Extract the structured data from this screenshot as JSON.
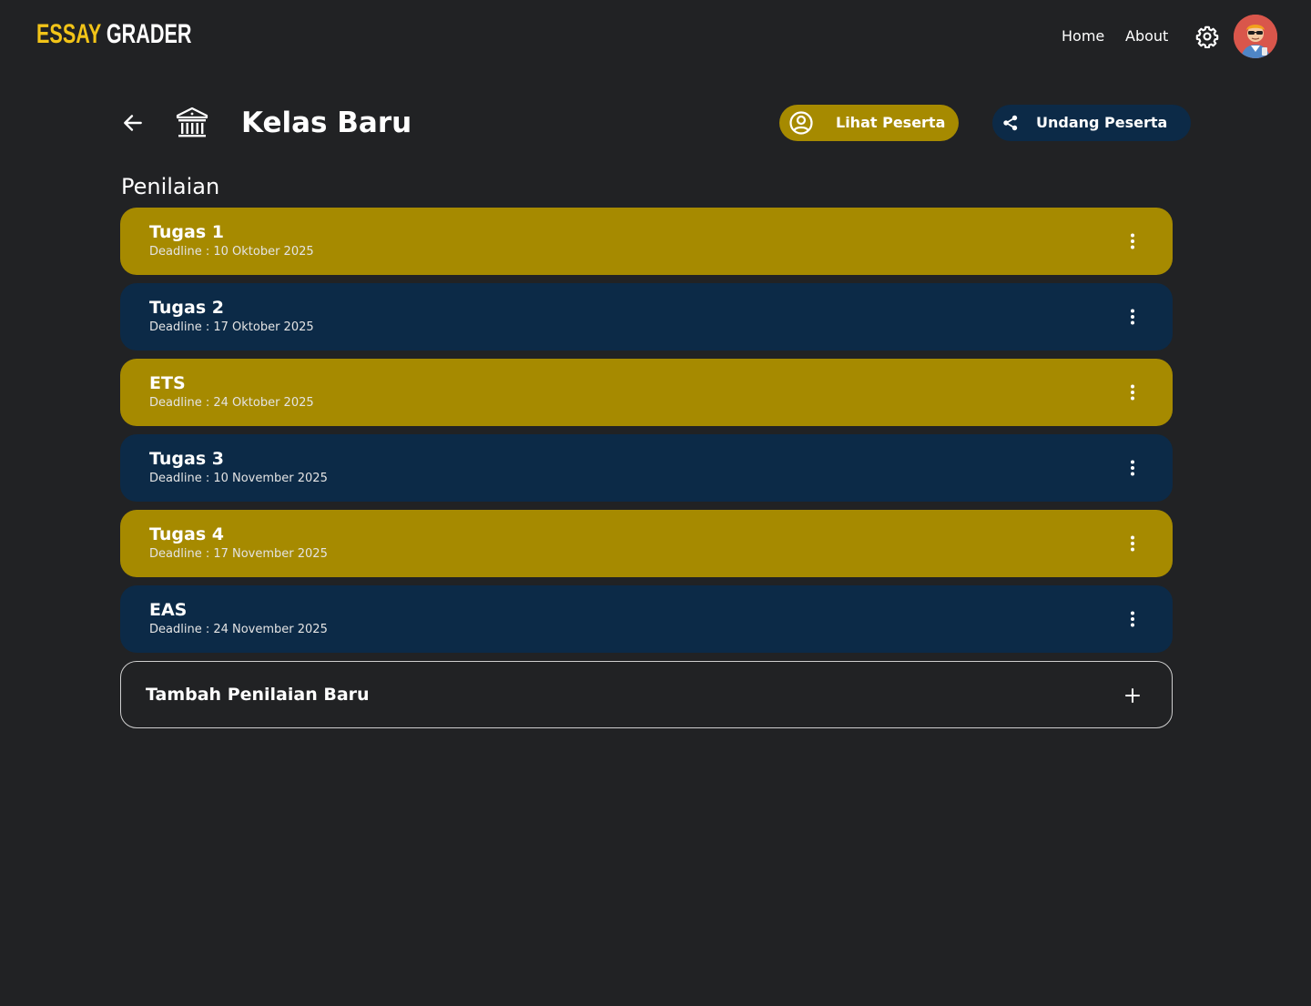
{
  "app": {
    "logo_part1": "ESSAY",
    "logo_part2": "GRADER"
  },
  "nav": {
    "home": "Home",
    "about": "About"
  },
  "page": {
    "title": "Kelas Baru",
    "section_title": "Penilaian",
    "btn_lihat": "Lihat Peserta",
    "btn_undang": "Undang Peserta",
    "add_label": "Tambah Penilaian Baru"
  },
  "colors": {
    "background": "#212224",
    "gold": "#A68A00",
    "navy": "#0C2A47",
    "logo_yellow": "#F2C418"
  },
  "icons": {
    "back": "arrow-left-icon",
    "class": "bank-building-icon",
    "settings": "gear-icon",
    "lihat": "account-circle-icon",
    "undang": "share-icon",
    "item_menu": "more-vertical-icon",
    "add": "plus-icon"
  },
  "assessments": [
    {
      "title": "Tugas 1",
      "deadline": "Deadline : 10 Oktober 2025",
      "color": "gold"
    },
    {
      "title": "Tugas 2",
      "deadline": "Deadline : 17 Oktober 2025",
      "color": "navy"
    },
    {
      "title": "ETS",
      "deadline": "Deadline : 24 Oktober 2025",
      "color": "gold"
    },
    {
      "title": "Tugas 3",
      "deadline": "Deadline : 10 November 2025",
      "color": "navy"
    },
    {
      "title": "Tugas 4",
      "deadline": "Deadline : 17 November 2025",
      "color": "gold"
    },
    {
      "title": "EAS",
      "deadline": "Deadline : 24 November 2025",
      "color": "navy"
    }
  ]
}
